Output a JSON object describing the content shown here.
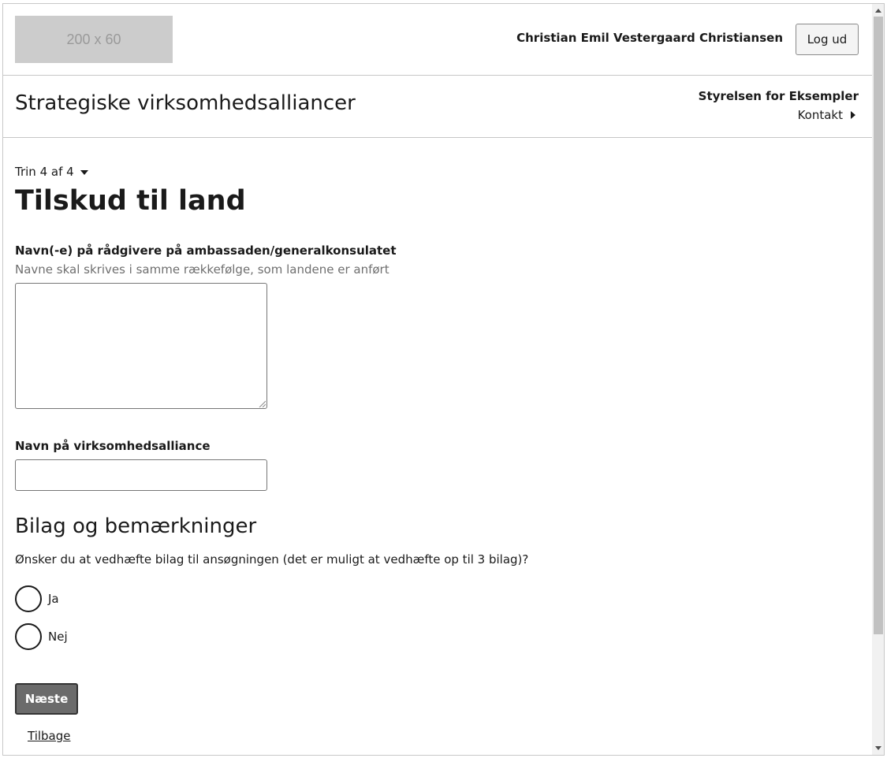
{
  "header": {
    "logo_text": "200 x 60",
    "user_name": "Christian Emil Vestergaard Christiansen",
    "logout_label": "Log ud"
  },
  "subheader": {
    "service_title": "Strategiske virksomhedsalliancer",
    "org_name": "Styrelsen for Eksempler",
    "contact_label": "Kontakt"
  },
  "main": {
    "step_indicator": "Trin 4 af 4",
    "page_title": "Tilskud til land",
    "advisors_label": "Navn(-e) på rådgivere på ambassaden/generalkonsulatet",
    "advisors_hint": "Navne skal skrives i samme rækkefølge, som landene er anført",
    "advisors_value": "",
    "alliance_label": "Navn på virksomhedsalliance",
    "alliance_value": "",
    "section_heading": "Bilag og bemærkninger",
    "attachments_question": "Ønsker du at vedhæfte bilag til ansøgningen (det er muligt at vedhæfte op til 3 bilag)?",
    "radio_options": [
      "Ja",
      "Nej"
    ],
    "next_label": "Næste",
    "back_label": "Tilbage"
  }
}
